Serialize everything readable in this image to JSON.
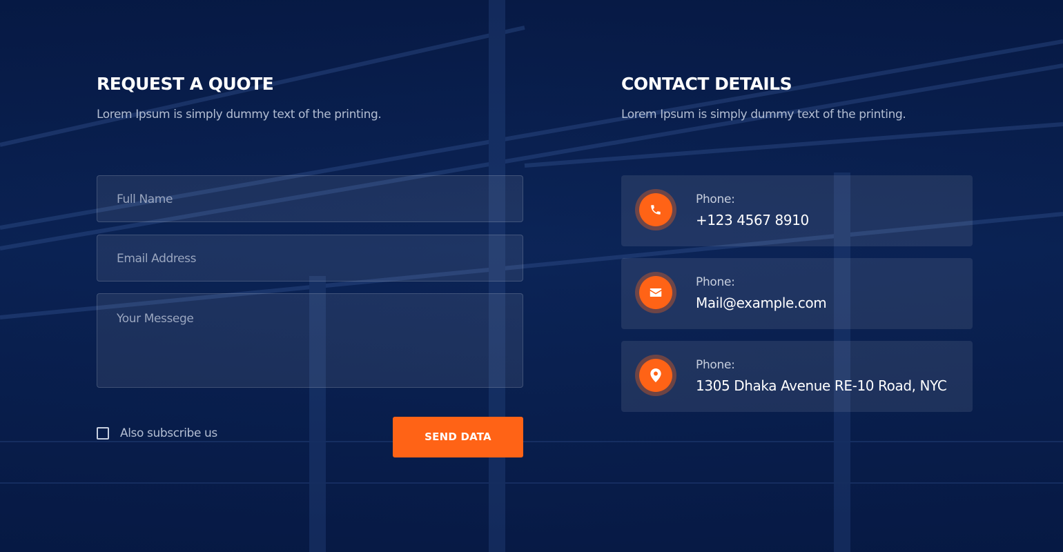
{
  "quote": {
    "title": "REQUEST A QUOTE",
    "subtitle": "Lorem Ipsum is simply dummy text of the printing.",
    "fields": {
      "name_placeholder": "Full Name",
      "email_placeholder": "Email Address",
      "message_placeholder": "Your Messege"
    },
    "subscribe_label": "Also subscribe us",
    "subscribe_checked": false,
    "send_label": "SEND DATA"
  },
  "contact": {
    "title": "CONTACT DETAILS",
    "subtitle": "Lorem Ipsum is simply dummy text of the printing.",
    "items": [
      {
        "icon": "phone-icon",
        "label": "Phone:",
        "value": "+123 4567 8910"
      },
      {
        "icon": "envelope-icon",
        "label": "Phone:",
        "value": "Mail@example.com"
      },
      {
        "icon": "map-pin-icon",
        "label": "Phone:",
        "value": "1305 Dhaka Avenue RE-10 Road, NYC"
      }
    ]
  },
  "colors": {
    "accent": "#ff6316",
    "background": "#0a1f4a",
    "heading": "#ffffff",
    "muted_text": "#b3bed3"
  }
}
